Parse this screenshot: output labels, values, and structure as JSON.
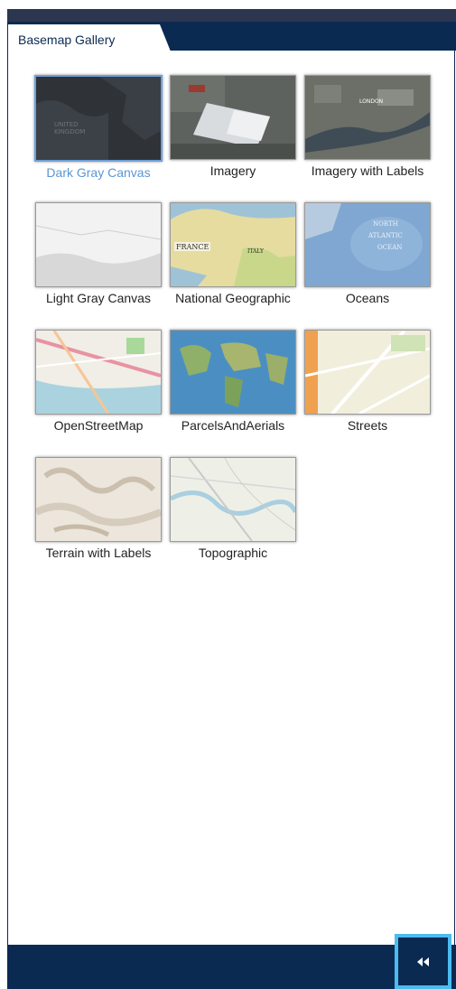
{
  "panel": {
    "title": "Basemap Gallery"
  },
  "basemaps": [
    {
      "label": "Dark Gray Canvas",
      "selected": true,
      "thumb": "dark-gray-canvas"
    },
    {
      "label": "Imagery",
      "selected": false,
      "thumb": "imagery"
    },
    {
      "label": "Imagery with Labels",
      "selected": false,
      "thumb": "imagery-labels"
    },
    {
      "label": "Light Gray Canvas",
      "selected": false,
      "thumb": "light-gray-canvas"
    },
    {
      "label": "National Geographic",
      "selected": false,
      "thumb": "national-geographic"
    },
    {
      "label": "Oceans",
      "selected": false,
      "thumb": "oceans"
    },
    {
      "label": "OpenStreetMap",
      "selected": false,
      "thumb": "openstreetmap"
    },
    {
      "label": "ParcelsAndAerials",
      "selected": false,
      "thumb": "parcels-aerials"
    },
    {
      "label": "Streets",
      "selected": false,
      "thumb": "streets"
    },
    {
      "label": "Terrain with Labels",
      "selected": false,
      "thumb": "terrain-labels"
    },
    {
      "label": "Topographic",
      "selected": false,
      "thumb": "topographic"
    }
  ],
  "footer": {
    "collapse_icon": "double-chevron-left-icon"
  },
  "colors": {
    "navy": "#0b2a52",
    "selected_label": "#5b96d4",
    "focus_border": "#4bbcf0"
  }
}
